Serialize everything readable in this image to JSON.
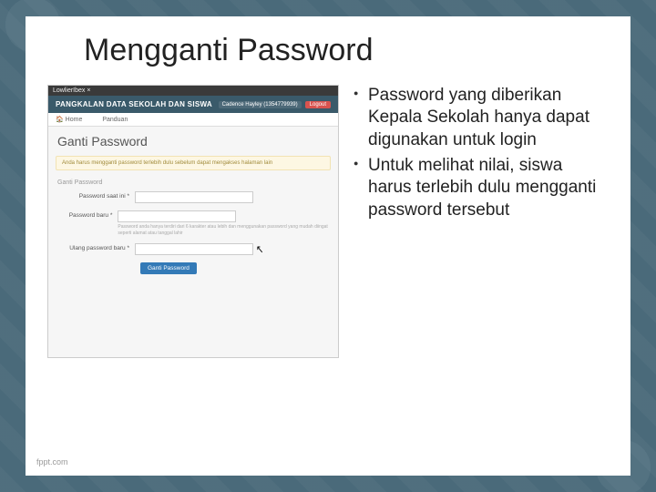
{
  "slide": {
    "title": "Mengganti Password"
  },
  "bullets": {
    "item1": "Password yang diberikan Kepala Sekolah hanya dapat digunakan untuk login",
    "item2": "Untuk melihat nilai, siswa harus terlebih dulu mengganti password tersebut"
  },
  "app": {
    "window_title": "LowlierIbex ×",
    "banner_title": "PANGKALAN DATA SEKOLAH DAN SISWA",
    "user_label": "Cadence Hayley (1354779939)",
    "logout": "Logout",
    "tab_home": "Home",
    "tab_panduan": "Panduan",
    "page_heading": "Ganti Password",
    "alert": "Anda harus mengganti password terlebih dulu sebelum dapat mengakses halaman lain",
    "section": "Ganti Password",
    "label_current": "Password saat ini *",
    "label_new": "Password baru *",
    "helper_new": "Password anda hanya terdiri dari 6 karakter atau lebih dan menggunakan password yang mudah diingat seperti alamat atau tanggal lahir",
    "label_repeat": "Ulang password baru *",
    "submit": "Ganti Password"
  },
  "footer": {
    "credit": "fppt.com"
  }
}
